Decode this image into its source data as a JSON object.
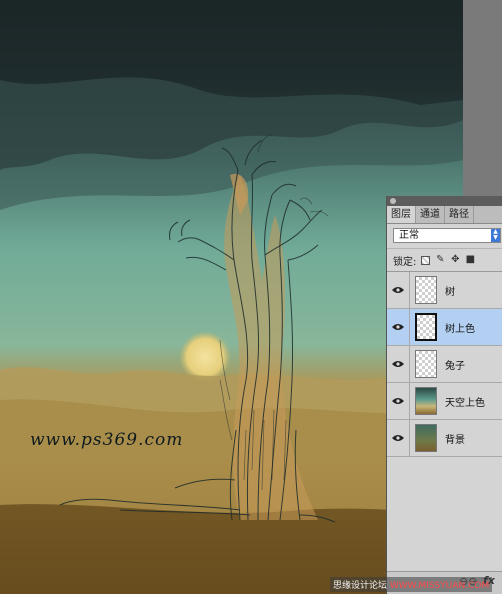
{
  "canvas": {
    "watermark": "www.ps369.com"
  },
  "layers_panel": {
    "tabs": [
      {
        "label": "图层",
        "active": true
      },
      {
        "label": "通道",
        "active": false
      },
      {
        "label": "路径",
        "active": false
      }
    ],
    "blend_mode": "正常",
    "lock_label": "锁定:",
    "lock_icons": [
      "lock-transparent-icon",
      "lock-brush-icon",
      "lock-move-icon",
      "lock-all-icon"
    ],
    "layers": [
      {
        "name": "树",
        "visible": true,
        "selected": false,
        "thumbnail": "transparent"
      },
      {
        "name": "树上色",
        "visible": true,
        "selected": true,
        "thumbnail": "transparent"
      },
      {
        "name": "兔子",
        "visible": true,
        "selected": false,
        "thumbnail": "transparent"
      },
      {
        "name": "天空上色",
        "visible": true,
        "selected": false,
        "thumbnail": "sky"
      },
      {
        "name": "背景",
        "visible": true,
        "selected": false,
        "thumbnail": "background"
      }
    ],
    "footer_icons": [
      "link-icon",
      "fx-icon"
    ],
    "fx_label": "fx"
  },
  "footer_credit": {
    "part1": "思缘设计论坛 ",
    "part2": "WWW.MISSYUAN.COM"
  },
  "colors": {
    "selected_layer": "#b3d0f2",
    "panel_bg": "#d4d4d4",
    "sky_top": "#1f2d2e",
    "sky_mid": "#6fa493",
    "ground": "#a78a48"
  }
}
